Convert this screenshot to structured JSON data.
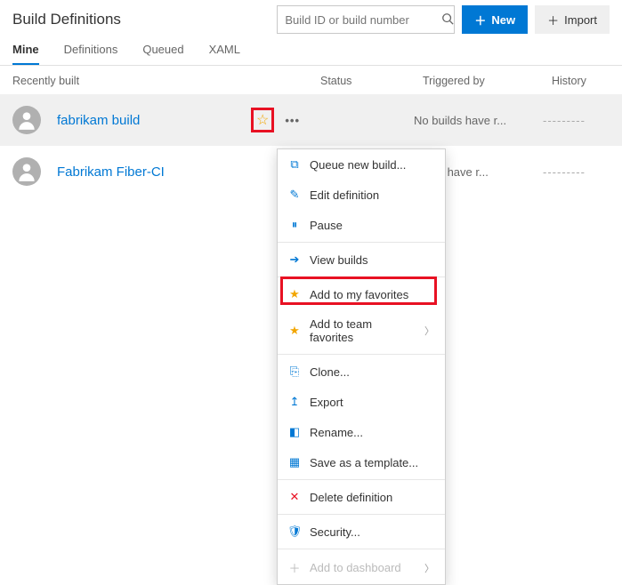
{
  "page": {
    "title": "Build Definitions",
    "search_placeholder": "Build ID or build number",
    "new_button": "New",
    "import_button": "Import"
  },
  "tabs": {
    "mine": "Mine",
    "definitions": "Definitions",
    "queued": "Queued",
    "xaml": "XAML"
  },
  "headers": {
    "recent": "Recently built",
    "status": "Status",
    "triggered_by": "Triggered by",
    "history": "History"
  },
  "rows": [
    {
      "name": "fabrikam build",
      "status": "",
      "triggered": "No builds have r..."
    },
    {
      "name": "Fabrikam Fiber-CI",
      "status": "",
      "triggered": "builds have r..."
    }
  ],
  "menu": {
    "queue": "Queue new build...",
    "edit": "Edit definition",
    "pause": "Pause",
    "view": "View builds",
    "add_my_fav": "Add to my favorites",
    "add_team_fav": "Add to team favorites",
    "clone": "Clone...",
    "export": "Export",
    "rename": "Rename...",
    "save_tmpl": "Save as a template...",
    "delete": "Delete definition",
    "security": "Security...",
    "dashboard": "Add to dashboard"
  },
  "misc": {
    "dashes": "---------"
  }
}
